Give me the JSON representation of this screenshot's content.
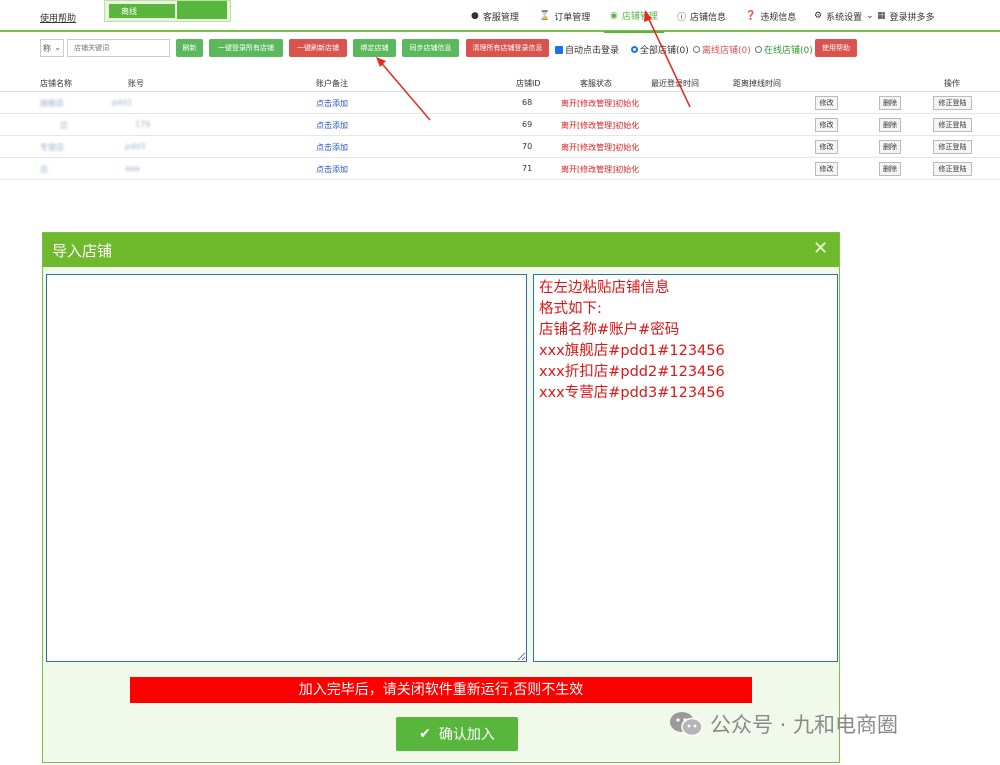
{
  "header": {
    "help_link": "使用帮助",
    "dropdown_option": "离线",
    "nav": [
      {
        "label": "客服管理",
        "icon": "chat-icon"
      },
      {
        "label": "订单管理",
        "icon": "hourglass-icon"
      },
      {
        "label": "店铺管理",
        "icon": "store-icon"
      },
      {
        "label": "店铺信息",
        "icon": "info-icon"
      },
      {
        "label": "违规信息",
        "icon": "question-icon"
      },
      {
        "label": "系统设置",
        "icon": "gear-icon"
      },
      {
        "label": "登录拼多多",
        "icon": "windows-icon"
      }
    ]
  },
  "toolbar": {
    "select_value": "称",
    "search_placeholder": "店铺关键词",
    "buttons": [
      "刷新",
      "一键登录所有店铺",
      "一键刷新店铺",
      "绑定店铺",
      "同步店铺信息",
      "清理所有店铺登录信息"
    ],
    "auto_login": "自动点击登录",
    "filters": [
      "全部店铺(0)",
      "离线店铺(0)",
      "在线店铺(0)"
    ],
    "usage_help": "使用帮助"
  },
  "table": {
    "headers": [
      "店铺名称",
      "账号",
      "账户备注",
      "店铺ID",
      "客服状态",
      "最近登录时间",
      "距离掉线时间",
      "操作"
    ],
    "rows": [
      {
        "name": "旗舰店",
        "account": "pdd1",
        "note": "点击添加",
        "id": "68",
        "status": "离开[修改管理]初始化"
      },
      {
        "name": "店",
        "account": "179",
        "note": "点击添加",
        "id": "69",
        "status": "离开[修改管理]初始化"
      },
      {
        "name": "专营店",
        "account": "pdd3",
        "note": "点击添加",
        "id": "70",
        "status": "离开[修改管理]初始化"
      },
      {
        "name": "店",
        "account": "aaa",
        "note": "点击添加",
        "id": "71",
        "status": "离开[修改管理]初始化"
      }
    ],
    "row_actions": [
      "修改",
      "删除",
      "修正登陆"
    ]
  },
  "modal": {
    "title": "导入店铺",
    "hint_lines": [
      "在左边粘贴店铺信息",
      "格式如下:",
      "店铺名称#账户#密码",
      "xxx旗舰店#pdd1#123456",
      "xxx折扣店#pdd2#123456",
      "xxx专营店#pdd3#123456"
    ],
    "warning": "加入完毕后，请关闭软件重新运行,否则不生效",
    "confirm_label": "确认加入"
  },
  "watermark": "公众号 · 九和电商圈",
  "colors": {
    "brand_green": "#6fb92c",
    "button_green": "#58b63c",
    "danger_red": "#d9534f",
    "hint_red": "#e01414"
  }
}
